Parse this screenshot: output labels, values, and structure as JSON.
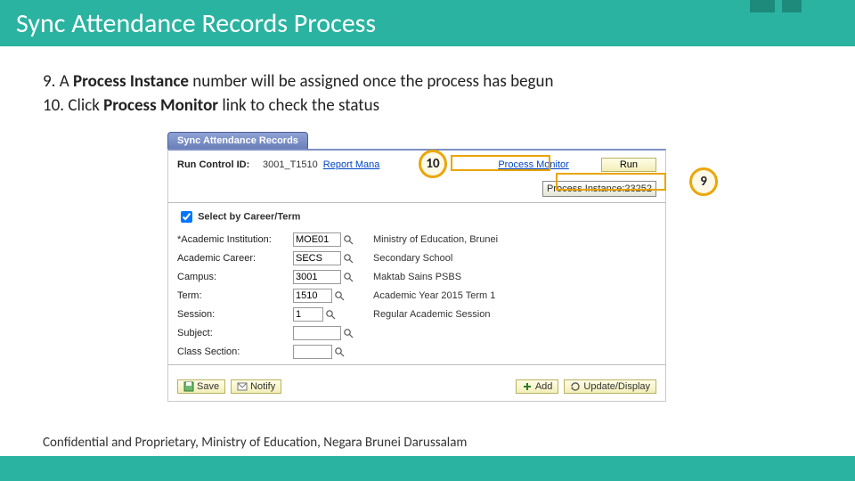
{
  "title": "Sync Attendance Records Process",
  "steps": {
    "nine_prefix": "9.   A ",
    "nine_bold": "Process Instance",
    "nine_suffix": " number will be assigned once the process has begun",
    "ten_prefix": "10. Click ",
    "ten_bold": "Process Monitor",
    "ten_suffix": " link to check the status"
  },
  "screenshot": {
    "tab_label": "Sync Attendance Records",
    "run_control_label": "Run Control ID:",
    "run_control_value": "3001_T1510",
    "report_manager_link": "Report Mana",
    "process_monitor_link": "Process Monitor",
    "run_button": "Run",
    "process_instance_label": "Process Instance:",
    "process_instance_value": "23252",
    "select_checkbox_label": "Select by Career/Term",
    "fields": {
      "institution": {
        "label": "Academic Institution:",
        "value": "MOE01",
        "desc": "Ministry of Education, Brunei"
      },
      "career": {
        "label": "Academic Career:",
        "value": "SECS",
        "desc": "Secondary School"
      },
      "campus": {
        "label": "Campus:",
        "value": "3001",
        "desc": "Maktab Sains PSBS"
      },
      "term": {
        "label": "Term:",
        "value": "1510",
        "desc": "Academic Year 2015 Term 1"
      },
      "session": {
        "label": "Session:",
        "value": "1",
        "desc": "Regular Academic Session"
      },
      "subject": {
        "label": "Subject:",
        "value": "",
        "desc": ""
      },
      "class_section": {
        "label": "Class Section:",
        "value": "",
        "desc": ""
      }
    },
    "buttons": {
      "save": "Save",
      "notify": "Notify",
      "add": "Add",
      "update_display": "Update/Display"
    }
  },
  "callouts": {
    "ten": "10",
    "nine": "9"
  },
  "footer": "Confidential and Proprietary, Ministry of Education, Negara Brunei Darussalam"
}
